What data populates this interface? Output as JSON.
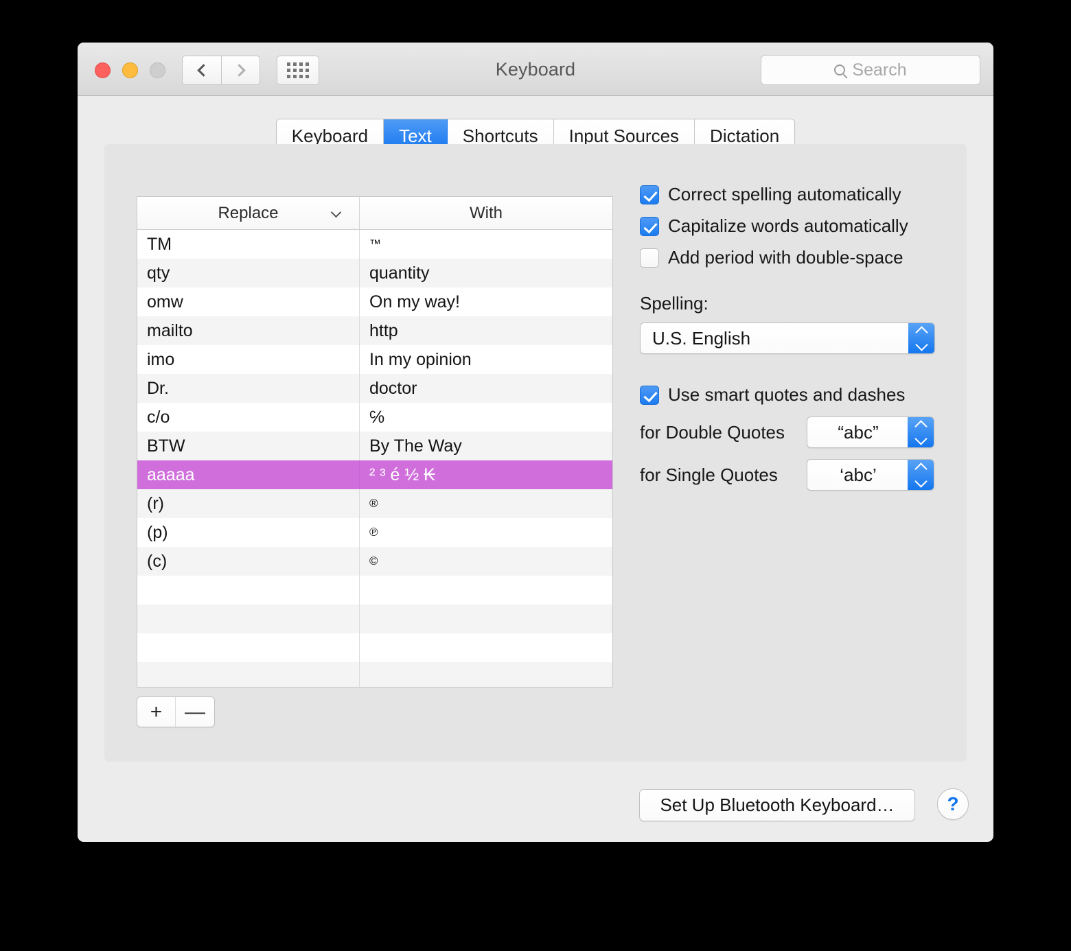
{
  "window": {
    "title": "Keyboard",
    "traffic_lights": [
      "close",
      "minimize",
      "zoom"
    ],
    "nav": {
      "back": "‹",
      "forward": "›",
      "grid": "show-all"
    },
    "search": {
      "placeholder": "Search",
      "value": ""
    }
  },
  "tabs": [
    {
      "label": "Keyboard",
      "active": false
    },
    {
      "label": "Text",
      "active": true
    },
    {
      "label": "Shortcuts",
      "active": false
    },
    {
      "label": "Input Sources",
      "active": false
    },
    {
      "label": "Dictation",
      "active": false
    }
  ],
  "table": {
    "columns": [
      "Replace",
      "With"
    ],
    "sort_column": "Replace",
    "rows": [
      {
        "replace": "TM",
        "with": "™",
        "with_small": true,
        "selected": false
      },
      {
        "replace": "qty",
        "with": "quantity",
        "with_small": false,
        "selected": false
      },
      {
        "replace": "omw",
        "with": "On my way!",
        "with_small": false,
        "selected": false
      },
      {
        "replace": "mailto",
        "with": "http",
        "with_small": false,
        "selected": false
      },
      {
        "replace": "imo",
        "with": "In my opinion",
        "with_small": false,
        "selected": false
      },
      {
        "replace": "Dr.",
        "with": "doctor",
        "with_small": false,
        "selected": false
      },
      {
        "replace": "c/o",
        "with": "℅",
        "with_small": false,
        "selected": false
      },
      {
        "replace": "BTW",
        "with": "By The Way",
        "with_small": false,
        "selected": false
      },
      {
        "replace": "aaaaa",
        "with": "² ³ é ½ ₭",
        "with_small": false,
        "selected": true
      },
      {
        "replace": "(r)",
        "with": "®",
        "with_small": true,
        "selected": false
      },
      {
        "replace": "(p)",
        "with": "℗",
        "with_small": true,
        "selected": false
      },
      {
        "replace": "(c)",
        "with": "©",
        "with_small": true,
        "selected": false
      },
      {
        "replace": "",
        "with": "",
        "with_small": false,
        "selected": false
      },
      {
        "replace": "",
        "with": "",
        "with_small": false,
        "selected": false
      },
      {
        "replace": "",
        "with": "",
        "with_small": false,
        "selected": false
      },
      {
        "replace": "",
        "with": "",
        "with_small": false,
        "selected": false
      }
    ],
    "add_label": "+",
    "remove_label": "—",
    "selection_color": "#d06fdc"
  },
  "options": {
    "correct_spelling": {
      "label": "Correct spelling automatically",
      "checked": true
    },
    "capitalize_words": {
      "label": "Capitalize words automatically",
      "checked": true
    },
    "add_period": {
      "label": "Add period with double-space",
      "checked": false
    },
    "spelling_label": "Spelling:",
    "spelling_value": "U.S. English",
    "smart_quotes": {
      "label": "Use smart quotes and dashes",
      "checked": true
    },
    "double_quotes_label": "for Double Quotes",
    "double_quotes_value": "“abc”",
    "single_quotes_label": "for Single Quotes",
    "single_quotes_value": "‘abc’"
  },
  "footer": {
    "bluetooth_button": "Set Up Bluetooth Keyboard…",
    "help_button": "?"
  },
  "colors": {
    "accent": "#1273ef",
    "selection": "#d06fdc",
    "window_bg": "#ececec",
    "panel_bg": "#e4e4e4"
  }
}
